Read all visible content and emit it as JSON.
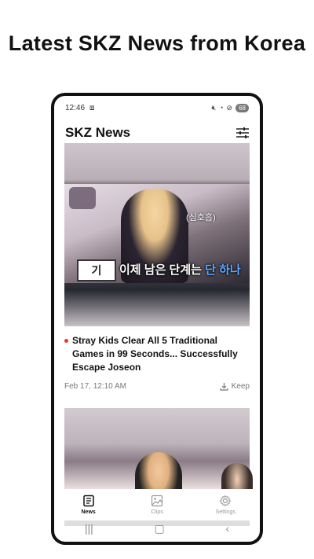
{
  "headline": "Latest SKZ News from Korea",
  "status_bar": {
    "time": "12:46",
    "battery": "68"
  },
  "app": {
    "title": "SKZ News"
  },
  "articles": [
    {
      "title": "Stray Kids Clear All 5 Traditional Games in 99 Seconds... Successfully Escape Joseon",
      "date": "Feb 17, 12:10 AM",
      "keep_label": "Keep",
      "thumbnail": {
        "score": "기",
        "caption_white": "이제 남은 단계는",
        "caption_blue": "단 하나",
        "tag": "(심호흡)"
      }
    }
  ],
  "tabs": [
    {
      "label": "News",
      "active": true,
      "icon": "newspaper-icon"
    },
    {
      "label": "Clips",
      "active": false,
      "icon": "image-icon"
    },
    {
      "label": "Settings",
      "active": false,
      "icon": "gear-icon"
    }
  ],
  "nav_buttons": [
    "recents-icon",
    "home-icon",
    "back-icon"
  ],
  "colors": {
    "bullet": "#e23a3a",
    "caption_blue": "#5ea8ff"
  }
}
